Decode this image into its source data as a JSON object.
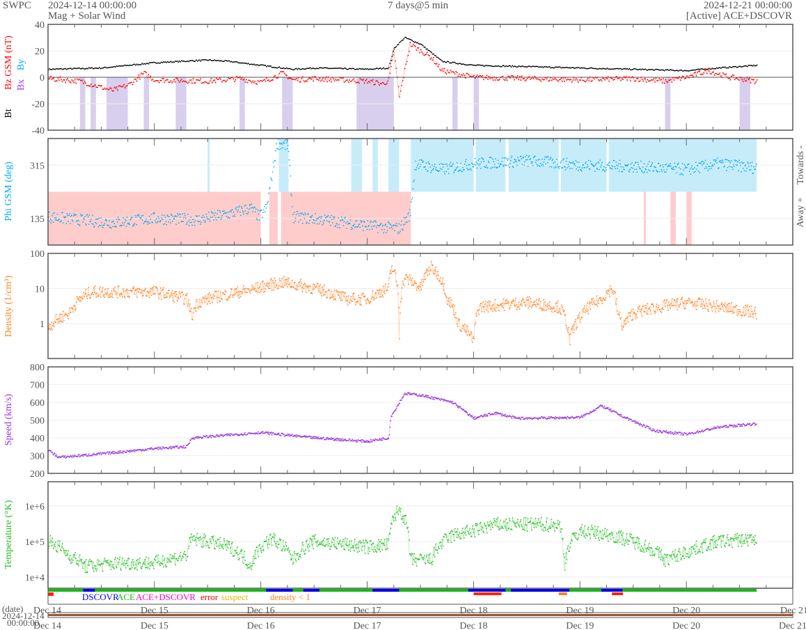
{
  "header": {
    "brand": "SWPC",
    "start": "2024-12-14 00:00:00",
    "subtitle": "Mag + Solar Wind",
    "span": "7 days@5 min",
    "end": "2024-12-21 00:00:00",
    "source": "[Active] ACE+DSCOVR"
  },
  "colors": {
    "bt": "#000000",
    "bz": "#ff0000",
    "bx": "#9933ff",
    "by": "#00aaff",
    "phi": "#00aaee",
    "density": "#ff7f1e",
    "speed": "#9933dd",
    "temp": "#22bb22",
    "bzneg": "#d8cfee",
    "towards": "#c6ecfa",
    "away": "#ffcccc"
  },
  "chart_data": [
    {
      "type": "line",
      "name": "mag",
      "ylabel_bt": "Bt",
      "ylabel_bz": "Bz GSM (nT)",
      "ylabel_bx": "Bx",
      "ylabel_by": "By",
      "ylim": [
        -40,
        40
      ],
      "yticks": [
        "40",
        "20",
        "0",
        "-20",
        "-40"
      ],
      "series": [
        {
          "name": "Bt",
          "points": [
            [
              0,
              6
            ],
            [
              0.5,
              7
            ],
            [
              1,
              11
            ],
            [
              1.5,
              13
            ],
            [
              1.7,
              12
            ],
            [
              2,
              9
            ],
            [
              2.3,
              6
            ],
            [
              2.5,
              7
            ],
            [
              3,
              6
            ],
            [
              3.2,
              7
            ],
            [
              3.25,
              22
            ],
            [
              3.35,
              30
            ],
            [
              3.5,
              25
            ],
            [
              3.7,
              12
            ],
            [
              4,
              9
            ],
            [
              4.5,
              8
            ],
            [
              5,
              7
            ],
            [
              5.5,
              6
            ],
            [
              6,
              5
            ],
            [
              6.3,
              7
            ],
            [
              6.66,
              9
            ]
          ]
        },
        {
          "name": "Bz",
          "points": [
            [
              0,
              -1
            ],
            [
              0.3,
              -3
            ],
            [
              0.6,
              -10
            ],
            [
              0.75,
              -6
            ],
            [
              0.9,
              3
            ],
            [
              1,
              -2
            ],
            [
              1.5,
              -3
            ],
            [
              1.8,
              -1
            ],
            [
              2,
              -4
            ],
            [
              2.2,
              3
            ],
            [
              2.3,
              -2
            ],
            [
              2.5,
              -1
            ],
            [
              3,
              -3
            ],
            [
              3.15,
              -5
            ],
            [
              3.2,
              -2
            ],
            [
              3.25,
              20
            ],
            [
              3.3,
              -15
            ],
            [
              3.4,
              25
            ],
            [
              3.6,
              15
            ],
            [
              3.7,
              5
            ],
            [
              4,
              0
            ],
            [
              4.5,
              -1
            ],
            [
              5,
              -2
            ],
            [
              5.5,
              -1
            ],
            [
              5.8,
              -3
            ],
            [
              6,
              0
            ],
            [
              6.2,
              5
            ],
            [
              6.4,
              0
            ],
            [
              6.66,
              -3
            ]
          ]
        }
      ],
      "bz_negative_ranges": [
        [
          0.3,
          0.35
        ],
        [
          0.4,
          0.45
        ],
        [
          0.55,
          0.75
        ],
        [
          0.9,
          0.95
        ],
        [
          1.2,
          1.3
        ],
        [
          1.8,
          1.85
        ],
        [
          2.2,
          2.3
        ],
        [
          2.9,
          3.25
        ],
        [
          3.8,
          3.85
        ],
        [
          4.0,
          4.05
        ],
        [
          5.8,
          5.85
        ],
        [
          6.5,
          6.6
        ]
      ]
    },
    {
      "type": "scatter",
      "name": "phi",
      "ylabel": "Phi GSM (deg)",
      "ylim": [
        45,
        405
      ],
      "yticks": [
        "315",
        "135"
      ],
      "right_labels": [
        "Towards -",
        "Away +"
      ],
      "points": [
        [
          0,
          140
        ],
        [
          0.3,
          130
        ],
        [
          0.6,
          120
        ],
        [
          1,
          135
        ],
        [
          1.4,
          130
        ],
        [
          1.7,
          150
        ],
        [
          1.9,
          170
        ],
        [
          1.98,
          140
        ],
        [
          2.05,
          170
        ],
        [
          2.15,
          390
        ],
        [
          2.25,
          380
        ],
        [
          2.3,
          140
        ],
        [
          2.6,
          130
        ],
        [
          3,
          110
        ],
        [
          3.3,
          100
        ],
        [
          3.4,
          150
        ],
        [
          3.45,
          320
        ],
        [
          3.7,
          300
        ],
        [
          4,
          320
        ],
        [
          4.5,
          330
        ],
        [
          5,
          315
        ],
        [
          5.5,
          310
        ],
        [
          6,
          300
        ],
        [
          6.3,
          320
        ],
        [
          6.66,
          305
        ]
      ],
      "away_ranges": [
        [
          0,
          2.0
        ],
        [
          2.08,
          2.16
        ],
        [
          2.19,
          3.41
        ],
        [
          5.6,
          5.62
        ],
        [
          5.85,
          5.9
        ],
        [
          6.0,
          6.05
        ]
      ],
      "towards_ranges": [
        [
          1.5,
          1.52
        ],
        [
          2.17,
          2.26
        ],
        [
          2.85,
          2.95
        ],
        [
          3.05,
          3.1
        ],
        [
          3.2,
          3.3
        ],
        [
          3.41,
          4.0
        ],
        [
          4.02,
          4.3
        ],
        [
          4.33,
          4.8
        ],
        [
          4.82,
          5.25
        ],
        [
          5.27,
          6.66
        ]
      ]
    },
    {
      "type": "line",
      "name": "density",
      "ylabel": "Density (1/cm³)",
      "scale": "log",
      "ylim": [
        0.1,
        100
      ],
      "yticks": [
        "100",
        "10",
        "1"
      ],
      "points": [
        [
          0,
          0.8
        ],
        [
          0.2,
          2
        ],
        [
          0.4,
          8
        ],
        [
          1,
          8
        ],
        [
          1.3,
          5
        ],
        [
          1.35,
          1.5
        ],
        [
          1.4,
          4
        ],
        [
          1.9,
          9
        ],
        [
          2.2,
          15
        ],
        [
          2.5,
          10
        ],
        [
          2.8,
          5
        ],
        [
          3,
          5
        ],
        [
          3.2,
          10
        ],
        [
          3.23,
          40
        ],
        [
          3.3,
          0.4
        ],
        [
          3.35,
          20
        ],
        [
          3.5,
          10
        ],
        [
          3.6,
          40
        ],
        [
          3.75,
          5
        ],
        [
          3.85,
          1
        ],
        [
          4,
          0.3
        ],
        [
          4.05,
          3
        ],
        [
          4.5,
          4
        ],
        [
          4.8,
          3
        ],
        [
          4.9,
          0.3
        ],
        [
          5,
          1.5
        ],
        [
          5.2,
          5
        ],
        [
          5.3,
          10
        ],
        [
          5.35,
          2
        ],
        [
          5.4,
          0.8
        ],
        [
          5.5,
          2
        ],
        [
          6,
          4
        ],
        [
          6.3,
          3
        ],
        [
          6.66,
          2
        ]
      ]
    },
    {
      "type": "line",
      "name": "speed",
      "ylabel": "Speed (km/s)",
      "ylim": [
        200,
        800
      ],
      "yticks": [
        "800",
        "700",
        "600",
        "500",
        "400",
        "300",
        "200"
      ],
      "points": [
        [
          0,
          330
        ],
        [
          0.1,
          290
        ],
        [
          0.5,
          310
        ],
        [
          1,
          340
        ],
        [
          1.3,
          350
        ],
        [
          1.35,
          400
        ],
        [
          2,
          430
        ],
        [
          2.5,
          400
        ],
        [
          3,
          380
        ],
        [
          3.2,
          400
        ],
        [
          3.22,
          520
        ],
        [
          3.35,
          650
        ],
        [
          3.5,
          640
        ],
        [
          3.8,
          600
        ],
        [
          4,
          510
        ],
        [
          4.2,
          540
        ],
        [
          4.4,
          510
        ],
        [
          5,
          515
        ],
        [
          5.2,
          580
        ],
        [
          5.4,
          520
        ],
        [
          5.7,
          440
        ],
        [
          6,
          420
        ],
        [
          6.3,
          460
        ],
        [
          6.66,
          480
        ]
      ]
    },
    {
      "type": "line",
      "name": "temperature",
      "ylabel": "Temperature (°K)",
      "scale": "log",
      "ylim": [
        5000,
        5000000
      ],
      "yticks": [
        "1e+6",
        "1e+5",
        "1e+4"
      ],
      "points": [
        [
          0,
          100000
        ],
        [
          0.2,
          40000
        ],
        [
          0.35,
          20000
        ],
        [
          0.7,
          25000
        ],
        [
          1,
          25000
        ],
        [
          1.3,
          40000
        ],
        [
          1.35,
          120000
        ],
        [
          1.7,
          70000
        ],
        [
          1.9,
          20000
        ],
        [
          2.1,
          120000
        ],
        [
          2.3,
          30000
        ],
        [
          2.5,
          100000
        ],
        [
          3,
          70000
        ],
        [
          3.2,
          80000
        ],
        [
          3.25,
          500000
        ],
        [
          3.3,
          800000
        ],
        [
          3.4,
          30000
        ],
        [
          3.6,
          30000
        ],
        [
          3.8,
          150000
        ],
        [
          4,
          200000
        ],
        [
          4.2,
          300000
        ],
        [
          4.5,
          300000
        ],
        [
          4.8,
          300000
        ],
        [
          4.85,
          20000
        ],
        [
          5,
          200000
        ],
        [
          5.3,
          150000
        ],
        [
          5.5,
          100000
        ],
        [
          5.8,
          30000
        ],
        [
          6,
          50000
        ],
        [
          6.3,
          100000
        ],
        [
          6.66,
          120000
        ]
      ]
    }
  ],
  "source_strip": {
    "legend": [
      "DSCOVR",
      "ACE",
      "ACE+DSCOVR",
      "error",
      "suspect",
      "density < 1"
    ],
    "dscovr_ranges": [
      [
        0.33,
        0.44
      ],
      [
        2.05,
        2.3
      ],
      [
        2.4,
        2.55
      ],
      [
        3.05,
        3.3
      ],
      [
        3.95,
        4.3
      ],
      [
        4.35,
        4.9
      ],
      [
        5.2,
        5.4
      ]
    ]
  },
  "xaxis": {
    "labels": [
      "Dec 14",
      "Dec 15",
      "Dec 16",
      "Dec 17",
      "Dec 18",
      "Dec 19",
      "Dec 20",
      "Dec 21"
    ],
    "date_label": "(date)",
    "date_start": "2024-12-14",
    "time_start": "00:00:00"
  }
}
